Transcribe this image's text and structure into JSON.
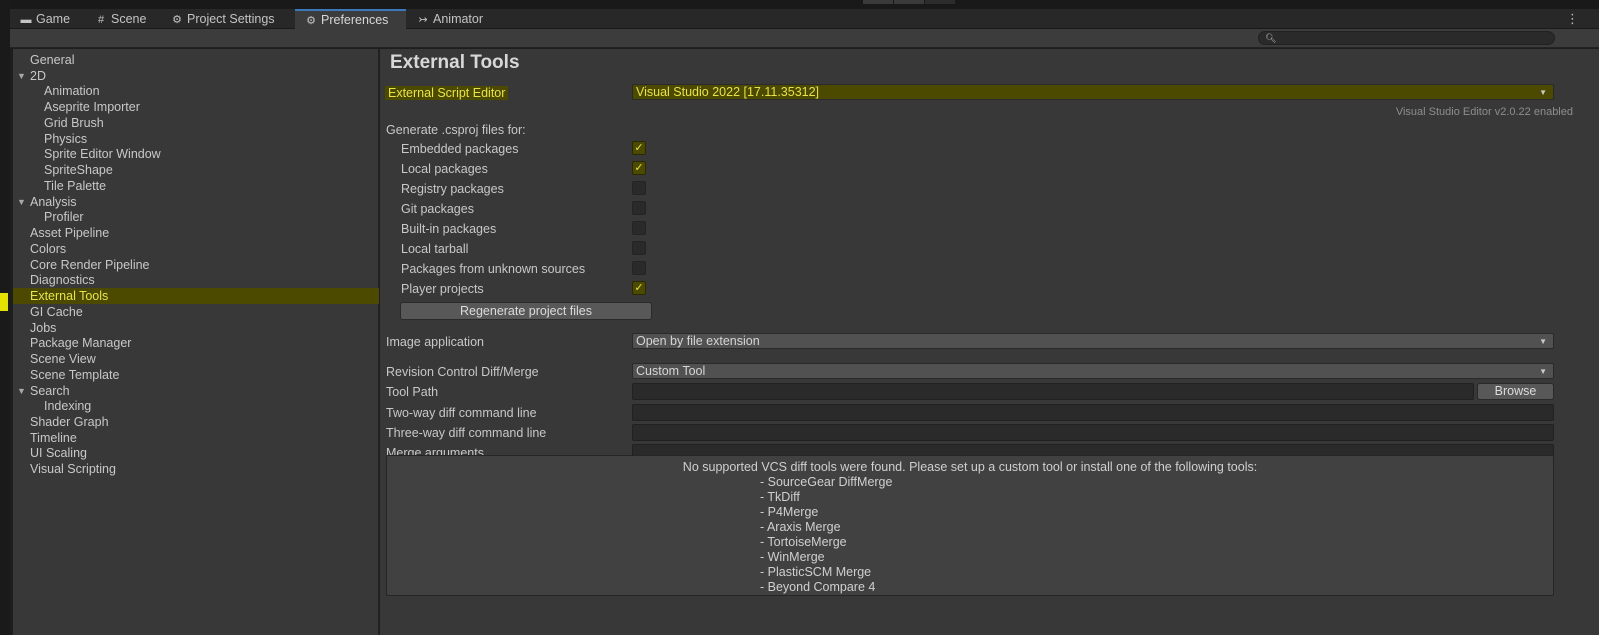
{
  "tabs": [
    {
      "label": "Game",
      "icon": "gamepad-icon"
    },
    {
      "label": "Scene",
      "icon": "grid-icon"
    },
    {
      "label": "Project Settings",
      "icon": "gear-icon"
    },
    {
      "label": "Preferences",
      "icon": "gear-icon",
      "active": true
    },
    {
      "label": "Animator",
      "icon": "animator-icon"
    }
  ],
  "search": {
    "placeholder": ""
  },
  "sidebar": {
    "items": [
      {
        "label": "General"
      },
      {
        "label": "2D",
        "expandable": true
      },
      {
        "label": "Animation"
      },
      {
        "label": "Aseprite Importer"
      },
      {
        "label": "Grid Brush"
      },
      {
        "label": "Physics"
      },
      {
        "label": "Sprite Editor Window"
      },
      {
        "label": "SpriteShape"
      },
      {
        "label": "Tile Palette"
      },
      {
        "label": "Analysis",
        "expandable": true
      },
      {
        "label": "Profiler"
      },
      {
        "label": "Asset Pipeline"
      },
      {
        "label": "Colors"
      },
      {
        "label": "Core Render Pipeline"
      },
      {
        "label": "Diagnostics"
      },
      {
        "label": "External Tools",
        "selected": true
      },
      {
        "label": "GI Cache"
      },
      {
        "label": "Jobs"
      },
      {
        "label": "Package Manager"
      },
      {
        "label": "Scene View"
      },
      {
        "label": "Scene Template"
      },
      {
        "label": "Search",
        "expandable": true
      },
      {
        "label": "Indexing"
      },
      {
        "label": "Shader Graph"
      },
      {
        "label": "Timeline"
      },
      {
        "label": "UI Scaling"
      },
      {
        "label": "Visual Scripting"
      }
    ]
  },
  "main": {
    "title": "External Tools",
    "script_editor": {
      "label": "External Script Editor",
      "value": "Visual Studio 2022 [17.11.35312]",
      "status": "Visual Studio Editor v2.0.22 enabled"
    },
    "csproj": {
      "heading": "Generate .csproj files for:",
      "options": [
        {
          "label": "Embedded packages",
          "checked": true
        },
        {
          "label": "Local packages",
          "checked": true
        },
        {
          "label": "Registry packages",
          "checked": false
        },
        {
          "label": "Git packages",
          "checked": false
        },
        {
          "label": "Built-in packages",
          "checked": false
        },
        {
          "label": "Local tarball",
          "checked": false
        },
        {
          "label": "Packages from unknown sources",
          "checked": false
        },
        {
          "label": "Player projects",
          "checked": true
        }
      ],
      "check_glyph": "✓",
      "regenerate_label": "Regenerate project files"
    },
    "image_app": {
      "label": "Image application",
      "value": "Open by file extension"
    },
    "revision": {
      "label": "Revision Control Diff/Merge",
      "value": "Custom Tool"
    },
    "tool_path": {
      "label": "Tool Path",
      "value": "",
      "browse_label": "Browse"
    },
    "two_way": {
      "label": "Two-way diff command line",
      "value": ""
    },
    "three_way": {
      "label": "Three-way diff command line",
      "value": ""
    },
    "merge_args": {
      "label": "Merge arguments",
      "value": ""
    },
    "help": {
      "heading": "No supported VCS diff tools were found. Please set up a custom tool or install one of the following tools:",
      "tools": [
        "- SourceGear DiffMerge",
        "- TkDiff",
        "- P4Merge",
        "- Araxis Merge",
        "- TortoiseMerge",
        "- WinMerge",
        "- PlasticSCM Merge",
        "- Beyond Compare 4"
      ]
    }
  },
  "colors": {
    "highlight_bg": "#4b4a00",
    "highlight_text": "#e8e34a",
    "active_tab_accent": "#3a79bb"
  }
}
